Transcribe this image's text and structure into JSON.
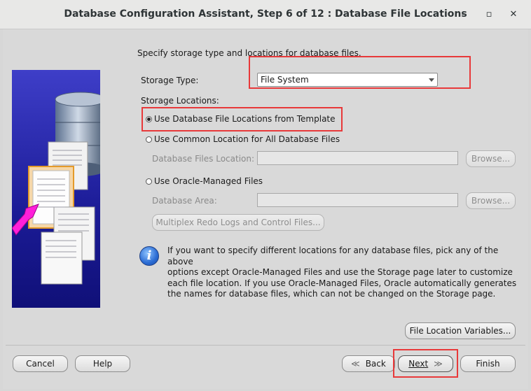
{
  "window": {
    "title": "Database Configuration Assistant, Step 6 of 12 : Database File Locations",
    "controls": {
      "minimize": "–",
      "maximize": "▫",
      "close": "✕"
    }
  },
  "intro": "Specify storage type and locations for database files.",
  "storage_type": {
    "label": "Storage Type:",
    "value": "File System"
  },
  "storage_locations": {
    "label": "Storage Locations:",
    "options": [
      {
        "label": "Use Database File Locations from Template",
        "selected": true
      },
      {
        "label": "Use Common Location for All Database Files",
        "selected": false
      },
      {
        "label": "Use Oracle-Managed Files",
        "selected": false
      }
    ],
    "database_files_location": {
      "label": "Database Files Location:",
      "value": "",
      "browse": "Browse..."
    },
    "database_area": {
      "label": "Database Area:",
      "value": "",
      "browse": "Browse..."
    },
    "multiplex_button": "Multiplex Redo Logs and Control Files..."
  },
  "info": {
    "icon": "info-icon",
    "lines": [
      "If you want to specify different locations for any database files, pick any of the above",
      "options except Oracle-Managed Files and use the Storage page later to customize",
      "each file location. If you use Oracle-Managed Files, Oracle automatically generates",
      "the names for database files, which can not be changed on the Storage page."
    ]
  },
  "file_location_variables": "File Location Variables...",
  "footer": {
    "cancel": "Cancel",
    "help": "Help",
    "back": "Back",
    "next": "Next",
    "finish": "Finish"
  },
  "colors": {
    "highlight": "#e8393a",
    "illustration_bg": "#2222a8",
    "accent": "#ff00ff"
  }
}
